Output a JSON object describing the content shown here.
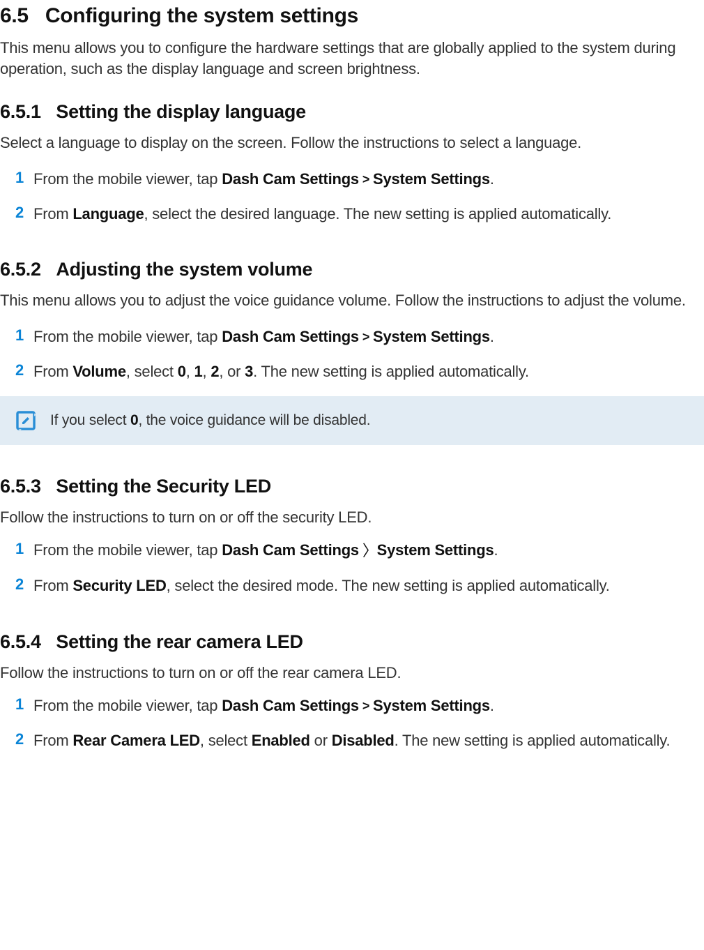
{
  "section65": {
    "num": "6.5",
    "title": "Configuring the system settings",
    "intro": "This menu allows you to configure the hardware settings that are globally applied to the system during operation, such as the display language and screen brightness."
  },
  "section651": {
    "num": "6.5.1",
    "title": "Setting the display language",
    "intro": "Select a language to display on the screen. Follow the instructions to select a language.",
    "step1": {
      "num": "1",
      "pre": "From the mobile viewer, tap ",
      "bold1": "Dash Cam Settings ",
      "bold2": " System Settings",
      "post": "."
    },
    "step2": {
      "num": "2",
      "pre": "From ",
      "bold": "Language",
      "post": ", select the desired language. The new setting is applied automatically."
    }
  },
  "section652": {
    "num": "6.5.2",
    "title": "Adjusting the system volume",
    "intro": "This menu allows you to adjust the voice guidance volume. Follow the instructions to adjust the volume.",
    "step1": {
      "num": "1",
      "pre": "From the mobile viewer, tap ",
      "bold1": "Dash Cam Settings ",
      "bold2": " System Settings",
      "post": "."
    },
    "step2": {
      "num": "2",
      "pre": "From ",
      "bVol": "Volume",
      "mid1": ", select ",
      "v0": "0",
      "c1": ", ",
      "v1": "1",
      "c2": ", ",
      "v2": "2",
      "c3": ", or ",
      "v3": "3",
      "post": ". The new setting is applied automatically."
    },
    "note": {
      "pre": "If you select ",
      "zero": "0",
      "post": ", the voice guidance will be disabled."
    }
  },
  "section653": {
    "num": "6.5.3",
    "title": "Setting the Security LED",
    "intro": "Follow the instructions to turn on or off the security LED.",
    "step1": {
      "num": "1",
      "pre": "From the mobile viewer, tap ",
      "bold1": "Dash Cam Settings ",
      "bold2": "System Settings",
      "post": "."
    },
    "step2": {
      "num": "2",
      "pre": "From ",
      "bold": "Security LED",
      "post": ", select the desired mode. The new setting is applied automatically."
    }
  },
  "section654": {
    "num": "6.5.4",
    "title": "Setting the rear camera LED",
    "intro": "Follow the instructions to turn on or off the rear camera LED.",
    "step1": {
      "num": "1",
      "pre": "From the mobile viewer, tap ",
      "bold1": "Dash Cam Settings ",
      "bold2": " System Settings",
      "post": "."
    },
    "step2": {
      "num": "2",
      "pre": "From ",
      "bold1": "Rear Camera LED",
      "mid": ", select ",
      "opt1": "Enabled",
      "or": " or ",
      "opt2": "Disabled",
      "post": ". The new setting is applied automatically."
    }
  }
}
